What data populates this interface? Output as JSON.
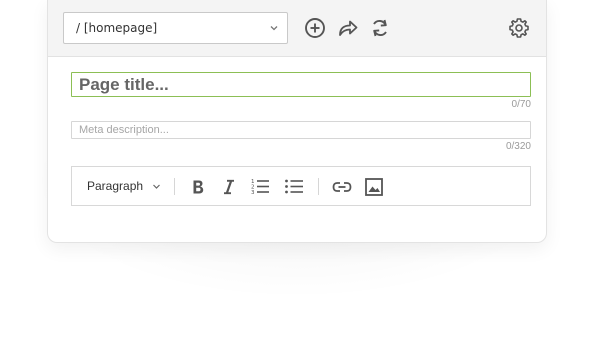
{
  "header": {
    "path_select_value": "/ [homepage]",
    "icons": [
      "add-circle-icon",
      "share-icon",
      "refresh-icon",
      "gear-icon"
    ]
  },
  "form": {
    "title_placeholder": "Page title...",
    "title_counter": "0/70",
    "meta_placeholder": "Meta description...",
    "meta_counter": "0/320"
  },
  "editor": {
    "block_format": "Paragraph",
    "tools": [
      "bold-icon",
      "italic-icon",
      "ordered-list-icon",
      "bullet-list-icon",
      "link-icon",
      "image-icon"
    ]
  },
  "colors": {
    "focus_border": "#8cbf55",
    "icon": "#555555",
    "toolbar_bg": "#f4f4f4"
  }
}
